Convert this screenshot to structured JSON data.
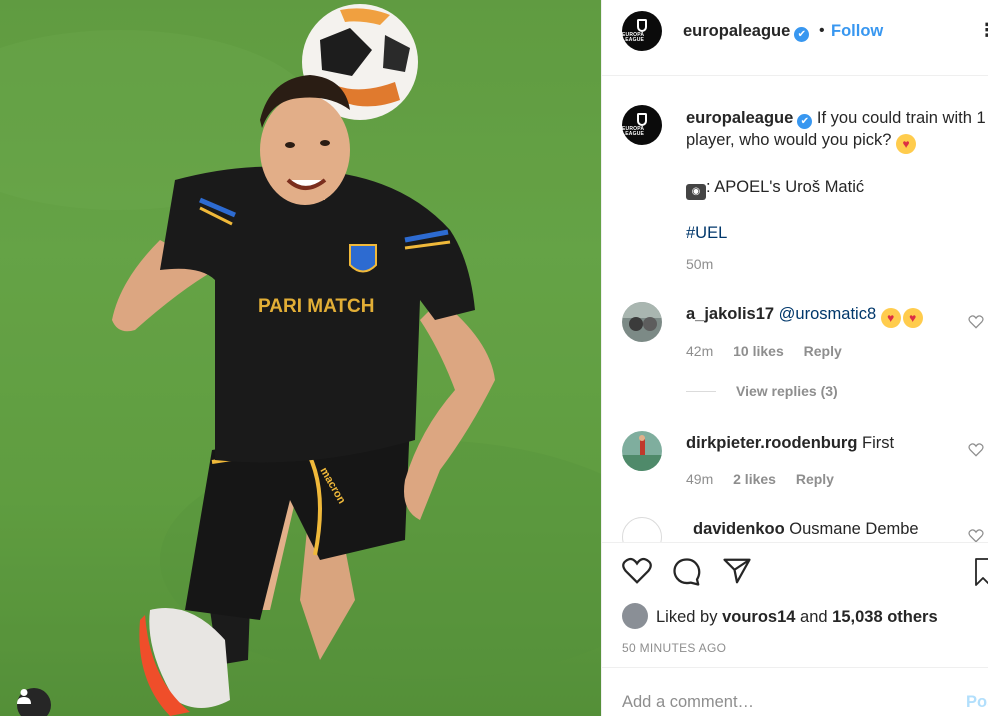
{
  "post": {
    "username": "europaleague",
    "verified_mark": "✔",
    "separator": "•",
    "follow_label": "Follow",
    "more_label": "•••",
    "avatar_logo_text": "EUROPA LEAGUE"
  },
  "photo": {
    "jersey_sponsor": "PARI MATCH",
    "shorts_brand": "macron",
    "user_tag_icon": "person-icon"
  },
  "caption": {
    "username": "europaleague",
    "text": "If you could train with 1 player, who would you pick?",
    "emoji": "😍",
    "credit_prefix": ": APOEL's Uroš Matić",
    "hashtag": "#UEL",
    "time": "50m"
  },
  "comments": [
    {
      "username": "a_jakolis17",
      "mention": "@urosmatic8",
      "emoji_count": 2,
      "time": "42m",
      "likes": "10 likes",
      "reply_label": "Reply",
      "view_replies": "View replies (3)"
    },
    {
      "username": "dirkpieter.roodenburg",
      "text": "First",
      "time": "49m",
      "likes": "2 likes",
      "reply_label": "Reply"
    },
    {
      "username": "davidenkoo",
      "text": "Ousmane Dembe"
    }
  ],
  "actions": {
    "liked_prefix": "Liked by",
    "liked_user": "vouros14",
    "liked_and": "and",
    "liked_others": "15,038 others",
    "timestamp": "50 MINUTES AGO",
    "add_comment_placeholder": "Add a comment…",
    "post_label": "Post"
  },
  "colors": {
    "link": "#3897f0",
    "mention": "#00376b",
    "muted": "#8e8e8e",
    "grass": "#66a447"
  }
}
